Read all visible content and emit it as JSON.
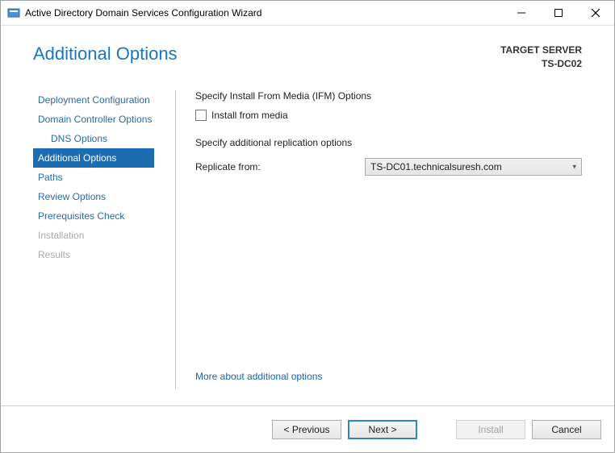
{
  "window": {
    "title": "Active Directory Domain Services Configuration Wizard"
  },
  "header": {
    "title": "Additional Options",
    "target_label": "TARGET SERVER",
    "target_value": "TS-DC02"
  },
  "sidebar": {
    "items": [
      {
        "label": "Deployment Configuration",
        "active": false,
        "disabled": false,
        "indent": false
      },
      {
        "label": "Domain Controller Options",
        "active": false,
        "disabled": false,
        "indent": false
      },
      {
        "label": "DNS Options",
        "active": false,
        "disabled": false,
        "indent": true
      },
      {
        "label": "Additional Options",
        "active": true,
        "disabled": false,
        "indent": false
      },
      {
        "label": "Paths",
        "active": false,
        "disabled": false,
        "indent": false
      },
      {
        "label": "Review Options",
        "active": false,
        "disabled": false,
        "indent": false
      },
      {
        "label": "Prerequisites Check",
        "active": false,
        "disabled": false,
        "indent": false
      },
      {
        "label": "Installation",
        "active": false,
        "disabled": true,
        "indent": false
      },
      {
        "label": "Results",
        "active": false,
        "disabled": true,
        "indent": false
      }
    ]
  },
  "main": {
    "ifm_heading": "Specify Install From Media (IFM) Options",
    "ifm_checkbox_label": "Install from media",
    "replication_heading": "Specify additional replication options",
    "replicate_from_label": "Replicate from:",
    "replicate_from_value": "TS-DC01.technicalsuresh.com",
    "more_link": "More about additional options"
  },
  "footer": {
    "previous": "< Previous",
    "next": "Next >",
    "install": "Install",
    "cancel": "Cancel"
  }
}
